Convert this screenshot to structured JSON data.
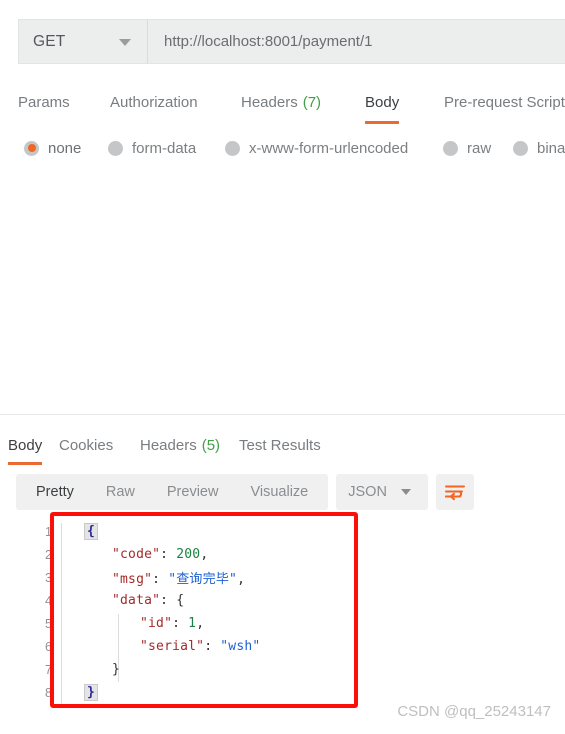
{
  "app": "Postman",
  "request": {
    "method": "GET",
    "method_caret_icon": "chevron-down-icon",
    "url": "http://localhost:8001/payment/1",
    "tabs": [
      {
        "label": "Params",
        "count": "",
        "active": false
      },
      {
        "label": "Authorization",
        "count": "",
        "active": false
      },
      {
        "label": "Headers",
        "count": "(7)",
        "active": false
      },
      {
        "label": "Body",
        "count": "",
        "active": true
      },
      {
        "label": "Pre-request Script",
        "count": "",
        "active": false
      }
    ],
    "body_types": [
      {
        "label": "none",
        "selected": true
      },
      {
        "label": "form-data",
        "selected": false
      },
      {
        "label": "x-www-form-urlencoded",
        "selected": false
      },
      {
        "label": "raw",
        "selected": false
      },
      {
        "label": "binary",
        "selected": false
      }
    ]
  },
  "response": {
    "tabs": [
      {
        "label": "Body",
        "count": "",
        "active": true
      },
      {
        "label": "Cookies",
        "count": "",
        "active": false
      },
      {
        "label": "Headers",
        "count": "(5)",
        "active": false
      },
      {
        "label": "Test Results",
        "count": "",
        "active": false
      }
    ],
    "view_modes": [
      {
        "label": "Pretty",
        "active": true
      },
      {
        "label": "Raw",
        "active": false
      },
      {
        "label": "Preview",
        "active": false
      },
      {
        "label": "Visualize",
        "active": false
      }
    ],
    "format": "JSON",
    "format_caret_icon": "chevron-down-icon",
    "wrap_icon": "word-wrap-icon",
    "body_lines": [
      {
        "no": "1",
        "indent": 0,
        "tokens": [
          {
            "t": "{",
            "c": "brace-hl"
          }
        ]
      },
      {
        "no": "2",
        "indent": 1,
        "tokens": [
          {
            "t": "\"code\"",
            "c": "k-key"
          },
          {
            "t": ": ",
            "c": "k-pun"
          },
          {
            "t": "200",
            "c": "k-num"
          },
          {
            "t": ",",
            "c": "k-pun"
          }
        ]
      },
      {
        "no": "3",
        "indent": 1,
        "tokens": [
          {
            "t": "\"msg\"",
            "c": "k-key"
          },
          {
            "t": ": ",
            "c": "k-pun"
          },
          {
            "t": "\"查询完毕\"",
            "c": "k-str"
          },
          {
            "t": ",",
            "c": "k-pun"
          }
        ]
      },
      {
        "no": "4",
        "indent": 1,
        "tokens": [
          {
            "t": "\"data\"",
            "c": "k-key"
          },
          {
            "t": ": {",
            "c": "k-pun"
          }
        ]
      },
      {
        "no": "5",
        "indent": 2,
        "tokens": [
          {
            "t": "\"id\"",
            "c": "k-key"
          },
          {
            "t": ": ",
            "c": "k-pun"
          },
          {
            "t": "1",
            "c": "k-num"
          },
          {
            "t": ",",
            "c": "k-pun"
          }
        ]
      },
      {
        "no": "6",
        "indent": 2,
        "tokens": [
          {
            "t": "\"serial\"",
            "c": "k-key"
          },
          {
            "t": ": ",
            "c": "k-pun"
          },
          {
            "t": "\"wsh\"",
            "c": "k-str"
          }
        ]
      },
      {
        "no": "7",
        "indent": 1,
        "tokens": [
          {
            "t": "}",
            "c": "k-pun"
          }
        ]
      },
      {
        "no": "8",
        "indent": 0,
        "tokens": [
          {
            "t": "}",
            "c": "brace-hl"
          }
        ]
      }
    ]
  },
  "annotation": {
    "color": "#fb0f08"
  },
  "watermark": "CSDN @qq_25243147",
  "colors": {
    "accent": "#eb6a33",
    "radio_selected": "#f26522",
    "count_green": "#43a047",
    "annotation_red": "#fb0f08"
  }
}
